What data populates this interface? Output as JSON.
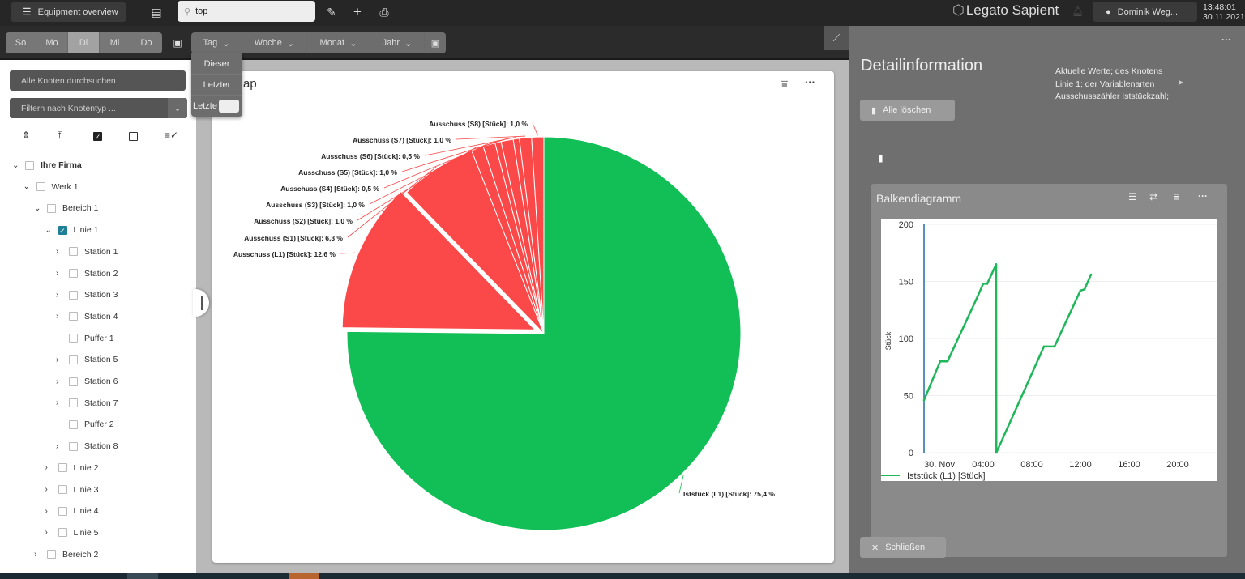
{
  "header": {
    "menu_label": "Equipment overview",
    "search_value": "top",
    "brand": "Legato Sapient",
    "user": "Dominik Weg...",
    "time": "13:48:01",
    "date": "30.11.2021"
  },
  "toolbar": {
    "days": [
      "So",
      "Mo",
      "Di",
      "Mi",
      "Do"
    ],
    "active_day": "Di",
    "periods": [
      "Tag",
      "Woche",
      "Monat",
      "Jahr"
    ],
    "dropdown": {
      "items": [
        "Dieser",
        "Letzter"
      ],
      "custom_label": "Letzte",
      "custom_value": ""
    }
  },
  "sidebar": {
    "search_placeholder": "Alle Knoten durchsuchen",
    "filter_placeholder": "Filtern nach Knotentyp ...",
    "tree": [
      {
        "label": "Ihre Firma",
        "level": 0,
        "exp": "open",
        "checked": false,
        "bold": true
      },
      {
        "label": "Werk 1",
        "level": 1,
        "exp": "open",
        "checked": false
      },
      {
        "label": "Bereich 1",
        "level": 2,
        "exp": "open",
        "checked": false
      },
      {
        "label": "Linie 1",
        "level": 3,
        "exp": "open",
        "checked": true
      },
      {
        "label": "Station 1",
        "level": 4,
        "exp": "closed",
        "checked": false
      },
      {
        "label": "Station 2",
        "level": 4,
        "exp": "closed",
        "checked": false
      },
      {
        "label": "Station 3",
        "level": 4,
        "exp": "closed",
        "checked": false
      },
      {
        "label": "Station 4",
        "level": 4,
        "exp": "closed",
        "checked": false
      },
      {
        "label": "Puffer 1",
        "level": 4,
        "exp": "none",
        "checked": false
      },
      {
        "label": "Station 5",
        "level": 4,
        "exp": "closed",
        "checked": false
      },
      {
        "label": "Station 6",
        "level": 4,
        "exp": "closed",
        "checked": false
      },
      {
        "label": "Station 7",
        "level": 4,
        "exp": "closed",
        "checked": false
      },
      {
        "label": "Puffer 2",
        "level": 4,
        "exp": "none",
        "checked": false
      },
      {
        "label": "Station 8",
        "level": 4,
        "exp": "closed",
        "checked": false
      },
      {
        "label": "Linie 2",
        "level": 3,
        "exp": "closed",
        "checked": false
      },
      {
        "label": "Linie 3",
        "level": 3,
        "exp": "closed",
        "checked": false
      },
      {
        "label": "Linie 4",
        "level": 3,
        "exp": "closed",
        "checked": false
      },
      {
        "label": "Linie 5",
        "level": 3,
        "exp": "closed",
        "checked": false
      },
      {
        "label": "Bereich 2",
        "level": 2,
        "exp": "closed",
        "checked": false
      }
    ]
  },
  "main": {
    "card_title": "ap"
  },
  "detail": {
    "title": "Detailinformation",
    "clear_all": "Alle löschen",
    "info_lines": [
      "Aktuelle Werte; des Knotens",
      "Linie 1; der Variablenarten",
      "Ausschusszähler Iststückzahl;"
    ],
    "chart_title": "Balkendiagramm",
    "close": "Schließen"
  },
  "chart_data": [
    {
      "type": "pie",
      "colors": {
        "good": "#12bf56",
        "scrap": "#fb4848"
      },
      "slices": [
        {
          "label": "Iststück (L1) [Stück]: 75,4 %",
          "value": 75.4,
          "color": "#12bf56"
        },
        {
          "label": "Ausschuss (L1) [Stück]: 12,6 %",
          "value": 12.6,
          "color": "#fb4848",
          "exploded": true
        },
        {
          "label": "Ausschuss (S1) [Stück]: 6,3 %",
          "value": 6.3,
          "color": "#fb4848"
        },
        {
          "label": "Ausschuss (S2) [Stück]: 1,0 %",
          "value": 1.0,
          "color": "#fb4848"
        },
        {
          "label": "Ausschuss (S3) [Stück]: 1,0 %",
          "value": 1.0,
          "color": "#fb4848"
        },
        {
          "label": "Ausschuss (S4) [Stück]: 0,5 %",
          "value": 0.5,
          "color": "#fb4848"
        },
        {
          "label": "Ausschuss (S5) [Stück]: 1,0 %",
          "value": 1.0,
          "color": "#fb4848"
        },
        {
          "label": "Ausschuss (S6) [Stück]: 0,5 %",
          "value": 0.5,
          "color": "#fb4848"
        },
        {
          "label": "Ausschuss (S7) [Stück]: 1,0 %",
          "value": 1.0,
          "color": "#fb4848"
        },
        {
          "label": "Ausschuss (S8) [Stück]: 1,0 %",
          "value": 1.0,
          "color": "#fb4848"
        }
      ]
    },
    {
      "type": "line",
      "ylabel": "Stück",
      "ylim": [
        0,
        200
      ],
      "yticks": [
        0,
        50,
        100,
        150,
        200
      ],
      "xticks": [
        "30. Nov",
        "04:00",
        "08:00",
        "12:00",
        "16:00",
        "20:00"
      ],
      "grid": true,
      "legend": "bottom-left",
      "series": [
        {
          "name": "Iststück (L1) [Stück]",
          "color": "#1fb75a",
          "points": [
            [
              "29.11. 23:08",
              46
            ],
            [
              "30.11. 00:28",
              80
            ],
            [
              "30.11. 01:04",
              80
            ],
            [
              "30.11. 03:28",
              135
            ],
            [
              "30.11. 04:00",
              148
            ],
            [
              "30.11. 04:20",
              148
            ],
            [
              "30.11. 05:04",
              165
            ],
            [
              "30.11. 05:05",
              0
            ],
            [
              "30.11. 09:00",
              93
            ],
            [
              "30.11. 09:52",
              93
            ],
            [
              "30.11. 12:00",
              142
            ],
            [
              "30.11. 12:20",
              143
            ],
            [
              "30.11. 12:52",
              156
            ]
          ]
        }
      ]
    }
  ]
}
